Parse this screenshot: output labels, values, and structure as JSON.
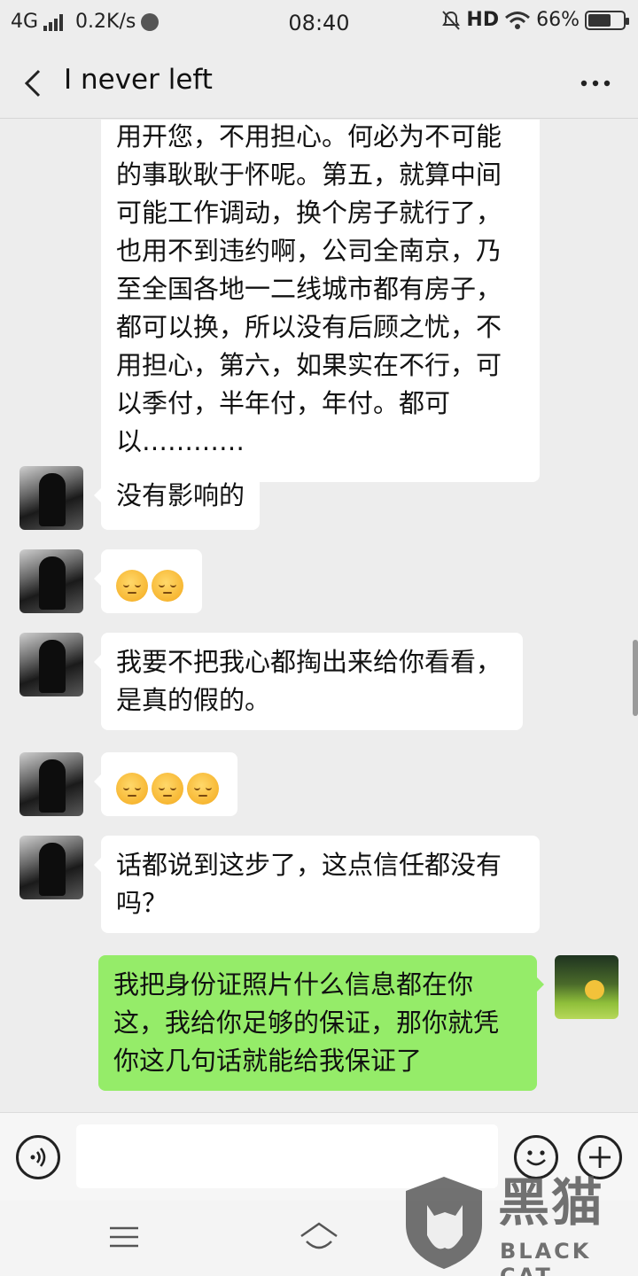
{
  "status_bar": {
    "network": "4G",
    "speed": "0.2K/s",
    "time": "08:40",
    "hd": "HD",
    "battery_text": "66%",
    "battery_level": 0.66
  },
  "header": {
    "title": "I never left",
    "back_icon": "chevron-left-icon",
    "more_icon": "more-horizontal-icon"
  },
  "messages": [
    {
      "from": "other",
      "kind": "text",
      "text": "用开您，不用担心。何必为不可能的事耿耿于怀呢。第五，就算中间可能工作调动，换个房子就行了，也用不到违约啊，公司全南京，乃至全国各地一二线城市都有房子，都可以换，所以没有后顾之忧，不用担心，第六，如果实在不行，可以季付，半年付，年付。都可以…………"
    },
    {
      "from": "other",
      "kind": "text",
      "text": "没有影响的"
    },
    {
      "from": "other",
      "kind": "emoji",
      "emoji_name": "pensive-face",
      "count": 2
    },
    {
      "from": "other",
      "kind": "text",
      "text": "我要不把我心都掏出来给你看看，是真的假的。"
    },
    {
      "from": "other",
      "kind": "emoji",
      "emoji_name": "pensive-face",
      "count": 3
    },
    {
      "from": "other",
      "kind": "text",
      "text": "话都说到这步了，这点信任都没有吗？"
    },
    {
      "from": "self",
      "kind": "text",
      "text": "我把身份证照片什么信息都在你这，我给你足够的保证，那你就凭你这几句话就能给我保证了"
    }
  ],
  "input_bar": {
    "placeholder": "",
    "voice_icon": "voice-icon",
    "emoji_icon": "emoji-icon",
    "plus_icon": "plus-icon"
  },
  "nav_bar": {
    "menu_icon": "menu-icon",
    "home_icon": "home-icon"
  },
  "watermark": {
    "title": "黑猫",
    "subtitle": "BLACK CAT"
  },
  "colors": {
    "background": "#ededed",
    "received_bubble": "#ffffff",
    "sent_bubble": "#95ec69"
  }
}
